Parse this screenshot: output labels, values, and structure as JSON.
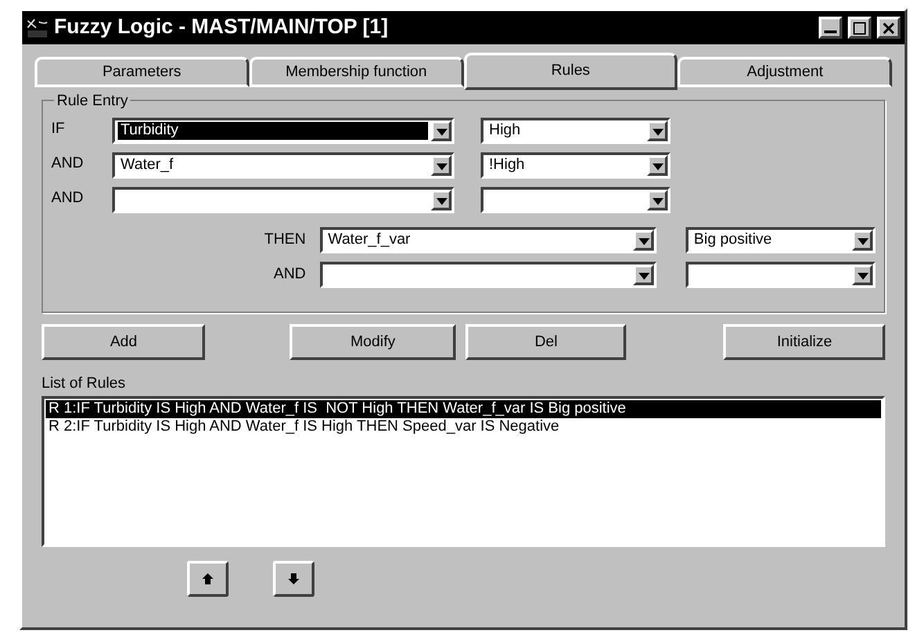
{
  "window": {
    "title": "Fuzzy Logic - MAST/MAIN/TOP [1]"
  },
  "tabs": [
    {
      "label": "Parameters",
      "selected": false
    },
    {
      "label": "Membership function",
      "selected": false
    },
    {
      "label": "Rules",
      "selected": true
    },
    {
      "label": "Adjustment",
      "selected": false
    }
  ],
  "rule_entry": {
    "title": "Rule Entry",
    "conditions": [
      {
        "label": "IF",
        "variable": "Turbidity",
        "variable_highlighted": true,
        "value": "High"
      },
      {
        "label": "AND",
        "variable": "Water_f",
        "variable_highlighted": false,
        "value": "!High"
      },
      {
        "label": "AND",
        "variable_highlighted": false
      }
    ],
    "consequences": [
      {
        "label": "THEN",
        "variable": "Water_f_var",
        "value": "Big positive"
      },
      {
        "label": "AND"
      }
    ]
  },
  "buttons": [
    "Add",
    "Modify",
    "Del",
    "Initialize"
  ],
  "rules_list": {
    "label": "List of Rules",
    "items": [
      {
        "text": "R 1:IF Turbidity IS High AND Water_f IS  NOT High THEN Water_f_var IS Big positive",
        "selected": true
      },
      {
        "text": "R 2:IF Turbidity IS High AND Water_f IS High THEN Speed_var IS Negative",
        "selected": false
      }
    ]
  }
}
